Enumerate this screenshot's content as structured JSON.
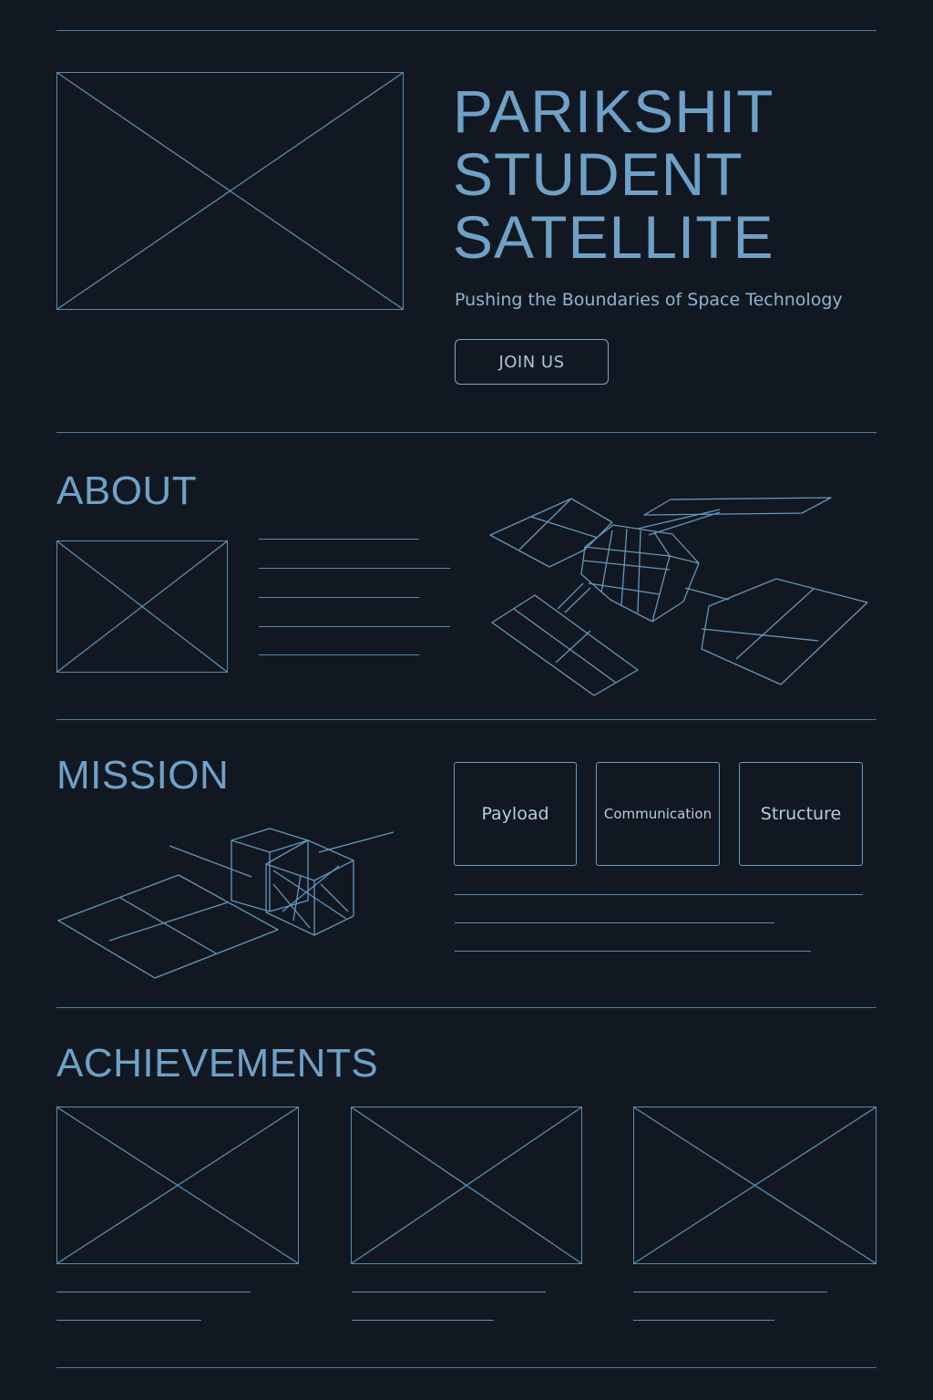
{
  "hero": {
    "title_lines": [
      "PARIKSHIT",
      "STUDENT",
      "SATELLITE"
    ],
    "tagline": "Pushing the Boundaries of Space Technology",
    "cta_label": "JOIN US"
  },
  "about": {
    "heading": "ABOUT"
  },
  "mission": {
    "heading": "MISSION",
    "cards": [
      {
        "label": "Payload"
      },
      {
        "label": "Communication"
      },
      {
        "label": "Structure"
      }
    ]
  },
  "achievements": {
    "heading": "ACHIEVEMENTS"
  },
  "colors": {
    "background": "#121821",
    "accent": "#6fa1c8",
    "wireframe_line": "#5a8bb0"
  }
}
